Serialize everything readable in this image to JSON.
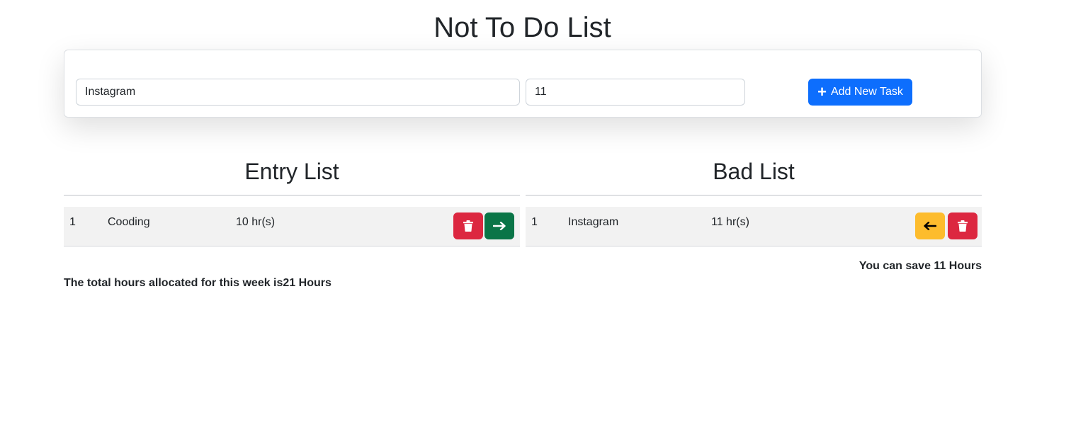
{
  "page": {
    "title": "Not To Do List"
  },
  "form": {
    "task_value": "Instagram",
    "hours_value": "11",
    "add_button_label": "Add New Task"
  },
  "entry_list": {
    "heading": "Entry List",
    "rows": [
      {
        "index": "1",
        "task": "Cooding",
        "hours": "10 hr(s)"
      }
    ]
  },
  "bad_list": {
    "heading": "Bad List",
    "rows": [
      {
        "index": "1",
        "task": "Instagram",
        "hours": "11 hr(s)"
      }
    ]
  },
  "summary": {
    "total_text": "The total hours allocated for this week is21 Hours",
    "save_prefix": "You can save ",
    "save_hours": "11",
    "save_suffix": " Hours"
  },
  "colors": {
    "primary": "#0d6efd",
    "danger": "#dc2740",
    "success": "#0a7547",
    "warning": "#fdbc2d"
  },
  "icons": {
    "add": "plus-icon",
    "delete": "trash-icon",
    "move_right": "arrow-right-icon",
    "move_left": "arrow-left-icon"
  }
}
